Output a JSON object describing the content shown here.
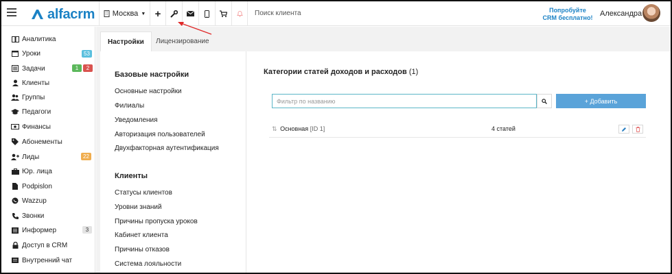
{
  "topbar": {
    "logo_text": "alfacrm",
    "branch": "Москва",
    "plus_label": "+",
    "search_placeholder": "Поиск клиента",
    "promo_line1": "Попробуйте",
    "promo_line2": "CRM бесплатно!",
    "username": "Александра",
    "brand_color": "#1b82c5"
  },
  "sidebar": {
    "items": [
      {
        "label": "Аналитика",
        "icon": "book-icon"
      },
      {
        "label": "Уроки",
        "icon": "calendar-icon",
        "badge": "53",
        "badge_color": "#5bc0de"
      },
      {
        "label": "Задачи",
        "icon": "tasks-icon",
        "badge": "1",
        "badge_color": "#5cb85c",
        "badge2": "2",
        "badge2_color": "#d9534f"
      },
      {
        "label": "Клиенты",
        "icon": "user-icon"
      },
      {
        "label": "Группы",
        "icon": "group-icon"
      },
      {
        "label": "Педагоги",
        "icon": "graduation-cap-icon"
      },
      {
        "label": "Финансы",
        "icon": "money-icon"
      },
      {
        "label": "Абонементы",
        "icon": "tag-icon"
      },
      {
        "label": "Лиды",
        "icon": "user-plus-icon",
        "badge": "22",
        "badge_color": "#f0ad4e"
      },
      {
        "label": "Юр. лица",
        "icon": "briefcase-icon"
      },
      {
        "label": "Podpislon",
        "icon": "file-icon"
      },
      {
        "label": "Wazzup",
        "icon": "whatsapp-icon"
      },
      {
        "label": "Звонки",
        "icon": "phone-icon"
      },
      {
        "label": "Информер",
        "icon": "newspaper-icon",
        "badge": "3",
        "badge_color": "#e3e3e3"
      },
      {
        "label": "Доступ в CRM",
        "icon": "lock-icon"
      },
      {
        "label": "Внутренний чат",
        "icon": "chat-icon"
      }
    ]
  },
  "tabs": [
    {
      "label": "Настройки",
      "active": true
    },
    {
      "label": "Лицензирование",
      "active": false
    }
  ],
  "settings_menu": {
    "basic_title": "Базовые настройки",
    "basic_links": [
      "Основные настройки",
      "Филиалы",
      "Уведомления",
      "Авторизация пользователей",
      "Двухфакторная аутентификация"
    ],
    "clients_title": "Клиенты",
    "clients_links": [
      "Статусы клиентов",
      "Уровни знаний",
      "Причины пропуска уроков",
      "Кабинет клиента",
      "Причины отказов",
      "Система лояльности"
    ]
  },
  "content": {
    "title": "Категории статей доходов и расходов",
    "count": "(1)",
    "filter_placeholder": "Фильтр по названию",
    "add_label": "+ Добавить",
    "rows": [
      {
        "drag": "⇅",
        "name": "Основная",
        "id": "[ID 1]",
        "count": "4 статей"
      }
    ]
  }
}
